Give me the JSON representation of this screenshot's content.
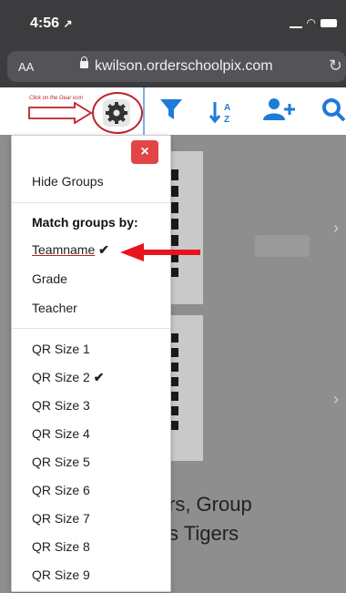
{
  "status": {
    "time": "4:56",
    "time_arrow": "↗"
  },
  "browser": {
    "aa_label": "AA",
    "url": "kwilson.orderschoolpix.com"
  },
  "toolbar": {
    "hint": "Click on the Gear icon",
    "filter_icon": "filter-icon",
    "sort_icon": "sort-az-icon",
    "add_user_icon": "add-user-icon",
    "search_icon": "search-icon"
  },
  "menu": {
    "close_label": "×",
    "hide_groups": "Hide Groups",
    "match_heading": "Match groups by:",
    "items": [
      {
        "label": "Teamname",
        "checked": true
      },
      {
        "label": "Grade",
        "checked": false
      },
      {
        "label": "Teacher",
        "checked": false
      }
    ],
    "qr_sizes": [
      {
        "label": "QR Size 1",
        "checked": false
      },
      {
        "label": "QR Size 2",
        "checked": true
      },
      {
        "label": "QR Size 3",
        "checked": false
      },
      {
        "label": "QR Size 4",
        "checked": false
      },
      {
        "label": "QR Size 5",
        "checked": false
      },
      {
        "label": "QR Size 6",
        "checked": false
      },
      {
        "label": "QR Size 7",
        "checked": false
      },
      {
        "label": "QR Size 8",
        "checked": false
      },
      {
        "label": "QR Size 9",
        "checked": false
      }
    ],
    "check_mark": "✔"
  },
  "background": {
    "line1": "rs, Group",
    "line2": "s Tigers",
    "chevron": "›"
  },
  "colors": {
    "accent": "#1e7bd6",
    "annotation_red": "#c0202a",
    "close_red": "#e24447"
  }
}
